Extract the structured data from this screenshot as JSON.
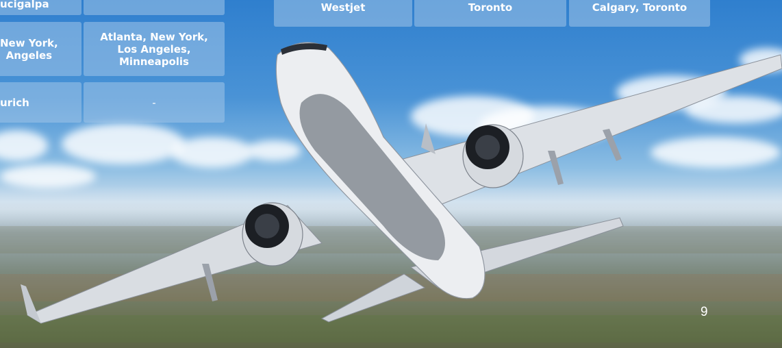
{
  "left_table": {
    "rows": [
      {
        "col1": "ucigalpa",
        "col2": ""
      },
      {
        "col1": "New York,\nAngeles",
        "col2": "Atlanta, New York,\nLos Angeles,\nMinneapolis"
      },
      {
        "col1": "urich",
        "col2": "-"
      }
    ]
  },
  "right_table": {
    "row": {
      "airline": "Westjet",
      "gateway": "Toronto",
      "cities": "Calgary, Toronto"
    }
  },
  "page_number": "9",
  "colors": {
    "cell_fill": "#a0c4e8",
    "text": "#ffffff"
  }
}
